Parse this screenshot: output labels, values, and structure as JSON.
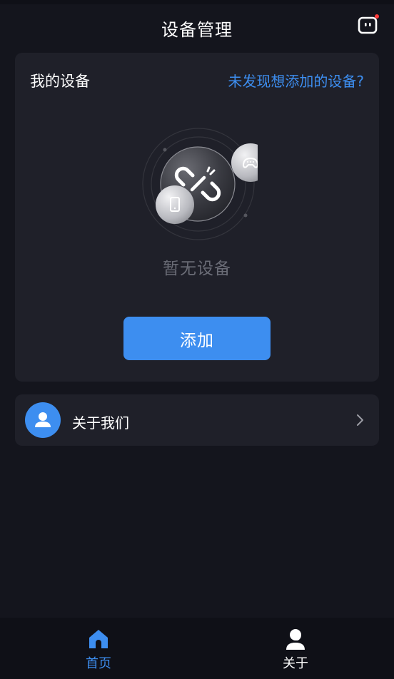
{
  "header": {
    "title": "设备管理",
    "notification_icon": "robot-chat-icon",
    "notification_dot_color": "#ff3b3b"
  },
  "device_card": {
    "title": "我的设备",
    "help_link": "未发现想添加的设备?",
    "illustration_icons": [
      "broken-link-icon",
      "phone-icon",
      "gamepad-icon"
    ],
    "empty_text": "暂无设备",
    "add_button": "添加"
  },
  "about_row": {
    "label": "关于我们",
    "icon": "user-icon"
  },
  "bottom_nav": {
    "items": [
      {
        "label": "首页",
        "icon": "home-icon",
        "active": true
      },
      {
        "label": "关于",
        "icon": "person-icon",
        "active": false
      }
    ]
  },
  "colors": {
    "background": "#14151d",
    "card": "#1f2029",
    "accent": "#3d8ef0",
    "muted_text": "#6a6c76"
  }
}
